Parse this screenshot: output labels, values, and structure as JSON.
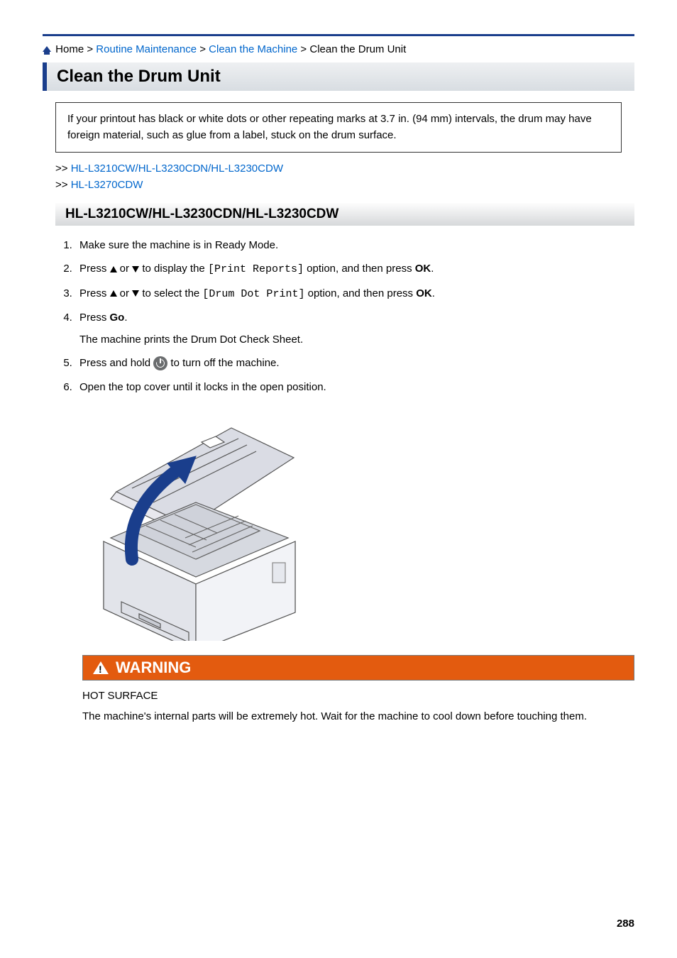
{
  "breadcrumb": {
    "home": "Home",
    "routine": "Routine Maintenance",
    "clean_machine": "Clean the Machine",
    "current": "Clean the Drum Unit",
    "sep": " > "
  },
  "title": "Clean the Drum Unit",
  "note": "If your printout has black or white dots or other repeating marks at 3.7 in. (94 mm) intervals, the drum may have foreign material, such as glue from a label, stuck on the drum surface.",
  "sublinks": {
    "prefix": ">> ",
    "link1": "HL-L3210CW/HL-L3230CDN/HL-L3230CDW",
    "link2": "HL-L3270CDW"
  },
  "section_header": "HL-L3210CW/HL-L3230CDN/HL-L3230CDW",
  "steps": {
    "s1": "Make sure the machine is in Ready Mode.",
    "s2a": "Press ",
    "s2b": " or ",
    "s2c": " to display the ",
    "s2code": "[Print Reports]",
    "s2d": " option, and then press ",
    "s2ok": "OK",
    "s2e": ".",
    "s3a": "Press ",
    "s3b": " or ",
    "s3c": " to select the ",
    "s3code": "[Drum Dot Print]",
    "s3d": " option, and then press ",
    "s3ok": "OK",
    "s3e": ".",
    "s4a": "Press ",
    "s4go": "Go",
    "s4b": ".",
    "s4sub": "The machine prints the Drum Dot Check Sheet.",
    "s5a": "Press and hold ",
    "s5b": " to turn off the machine.",
    "s6": "Open the top cover until it locks in the open position."
  },
  "warning": {
    "label": "WARNING",
    "hot": "HOT SURFACE",
    "body": "The machine's internal parts will be extremely hot. Wait for the machine to cool down before touching them."
  },
  "page_number": "288"
}
